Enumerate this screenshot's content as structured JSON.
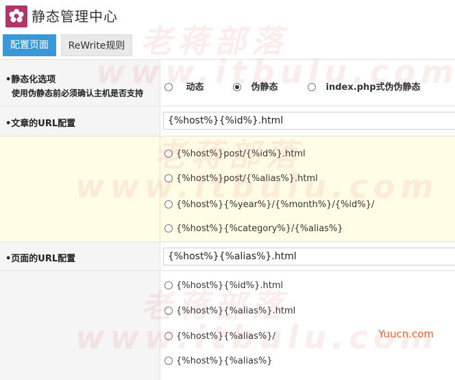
{
  "header": {
    "title": "静态管理中心",
    "logo_icon": "flower-icon",
    "logo_color": "#b3336b"
  },
  "tabs": [
    {
      "label": "配置页面",
      "active": true
    },
    {
      "label": "ReWrite规则",
      "active": false
    }
  ],
  "static_option": {
    "label": "•静态化选项",
    "sub_label": "使用伪静态前必须确认主机是否支持",
    "options": [
      "动态",
      "伪静态",
      "index.php式伪伪静态"
    ],
    "selected": "伪静态"
  },
  "article_url": {
    "label": "•文章的URL配置",
    "value": "{%host%}{%id%}.html",
    "options": [
      "{%host%}post/{%id%}.html",
      "{%host%}post/{%alias%}.html",
      "{%host%}{%year%}/{%month%}/{%id%}/",
      "{%host%}{%category%}/{%alias%}"
    ]
  },
  "page_url": {
    "label": "•页面的URL配置",
    "value": "{%host%}{%alias%}.html",
    "options": [
      "{%host%}{%id%}.html",
      "{%host%}{%alias%}.html",
      "{%host%}{%alias%}/",
      "{%host%}{%alias%}"
    ]
  },
  "watermarks": {
    "cn": "老蒋部落",
    "en": "www.itbulu.com",
    "corner": "Yuucn.com"
  },
  "colors": {
    "accent": "#3a98d8",
    "highlight_bg": "#fffde6",
    "label_bg": "#f5f5f5"
  }
}
